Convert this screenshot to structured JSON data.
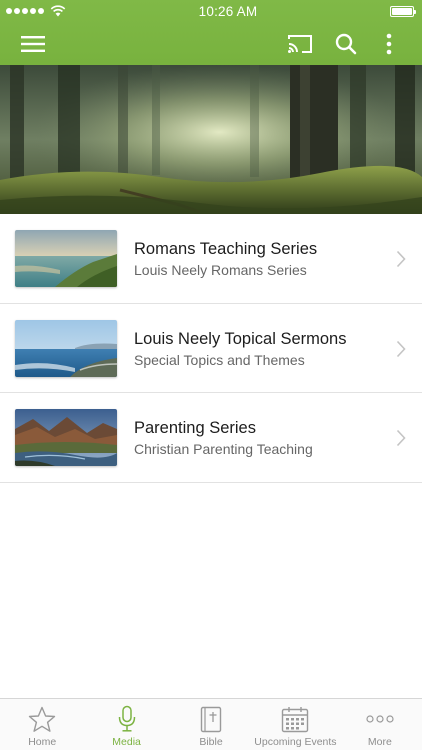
{
  "status_bar": {
    "time": "10:26 AM"
  },
  "header": {
    "menu_icon": "hamburger-menu-icon",
    "cast_icon": "cast-icon",
    "search_icon": "search-icon",
    "more_icon": "vertical-dots-icon",
    "color": "#7cb342"
  },
  "hero": {
    "image": "forest-sunlight-banner"
  },
  "series": [
    {
      "title": "Romans Teaching Series",
      "subtitle": "Louis Neely Romans Series",
      "image": "coastal-sunset-thumbnail"
    },
    {
      "title": "Louis Neely Topical Sermons",
      "subtitle": "Special Topics and Themes",
      "image": "ocean-coast-thumbnail"
    },
    {
      "title": "Parenting Series",
      "subtitle": "Christian Parenting Teaching",
      "image": "mountain-river-thumbnail"
    }
  ],
  "tabbar": {
    "tabs": [
      {
        "label": "Home",
        "icon": "star-icon",
        "active": false
      },
      {
        "label": "Media",
        "icon": "microphone-icon",
        "active": true
      },
      {
        "label": "Bible",
        "icon": "bible-icon",
        "active": false
      },
      {
        "label": "Upcoming Events",
        "icon": "calendar-icon",
        "active": false
      },
      {
        "label": "More",
        "icon": "more-dots-icon",
        "active": false
      }
    ],
    "active_color": "#7cb342",
    "inactive_color": "#8e8e8e"
  }
}
